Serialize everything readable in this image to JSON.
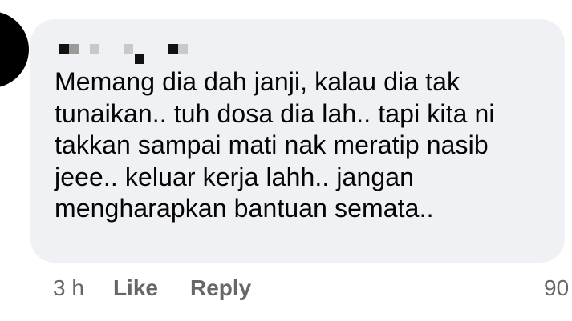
{
  "comment": {
    "lines": [
      "Memang dia dah janji, kalau dia tak",
      "tunaikan.. tuh dosa dia lah.. tapi kita ni",
      "takkan sampai mati nak meratip nasib",
      "jeee.. keluar kerja lahh.. jangan",
      "mengharapkan bantuan semata.."
    ]
  },
  "actions": {
    "time": "3 h",
    "like_label": "Like",
    "reply_label": "Reply",
    "reaction_count": "90"
  },
  "colors": {
    "bubble": "#eff1f4",
    "secondary_text": "#65676b",
    "body_text": "#050505"
  }
}
